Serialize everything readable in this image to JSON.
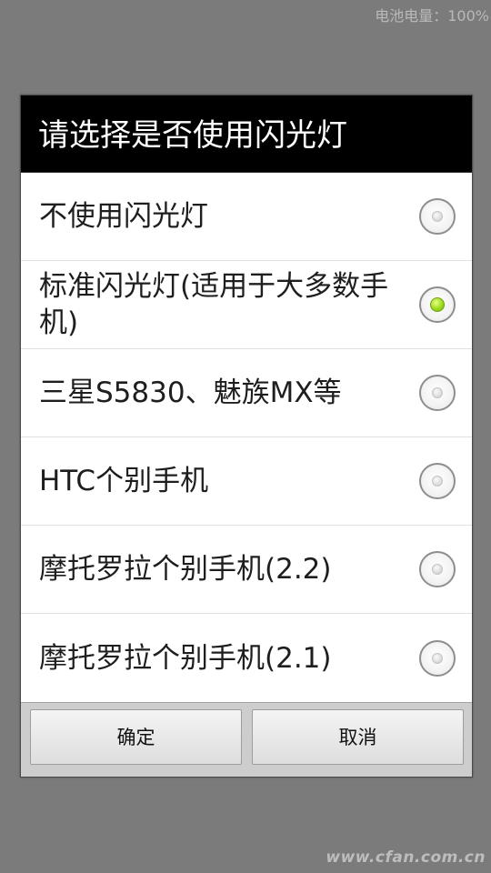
{
  "status_bar": {
    "battery_text": "电池电量：100%"
  },
  "dialog": {
    "title": "请选择是否使用闪光灯",
    "options": [
      {
        "label": "不使用闪光灯",
        "selected": false
      },
      {
        "label": "标准闪光灯(适用于大多数手机)",
        "selected": true
      },
      {
        "label": "三星S5830、魅族MX等",
        "selected": false
      },
      {
        "label": "HTC个别手机",
        "selected": false
      },
      {
        "label": "摩托罗拉个别手机(2.2)",
        "selected": false
      },
      {
        "label": "摩托罗拉个别手机(2.1)",
        "selected": false
      }
    ],
    "ok_label": "确定",
    "cancel_label": "取消"
  },
  "watermark": "www.cfan.com.cn",
  "colors": {
    "background": "#7b7b7b",
    "title_bar": "#000000",
    "selected_radio": "#9ddb1c"
  },
  "icons": {
    "radio_unchecked": "radio-unchecked-icon",
    "radio_checked": "radio-checked-icon"
  }
}
